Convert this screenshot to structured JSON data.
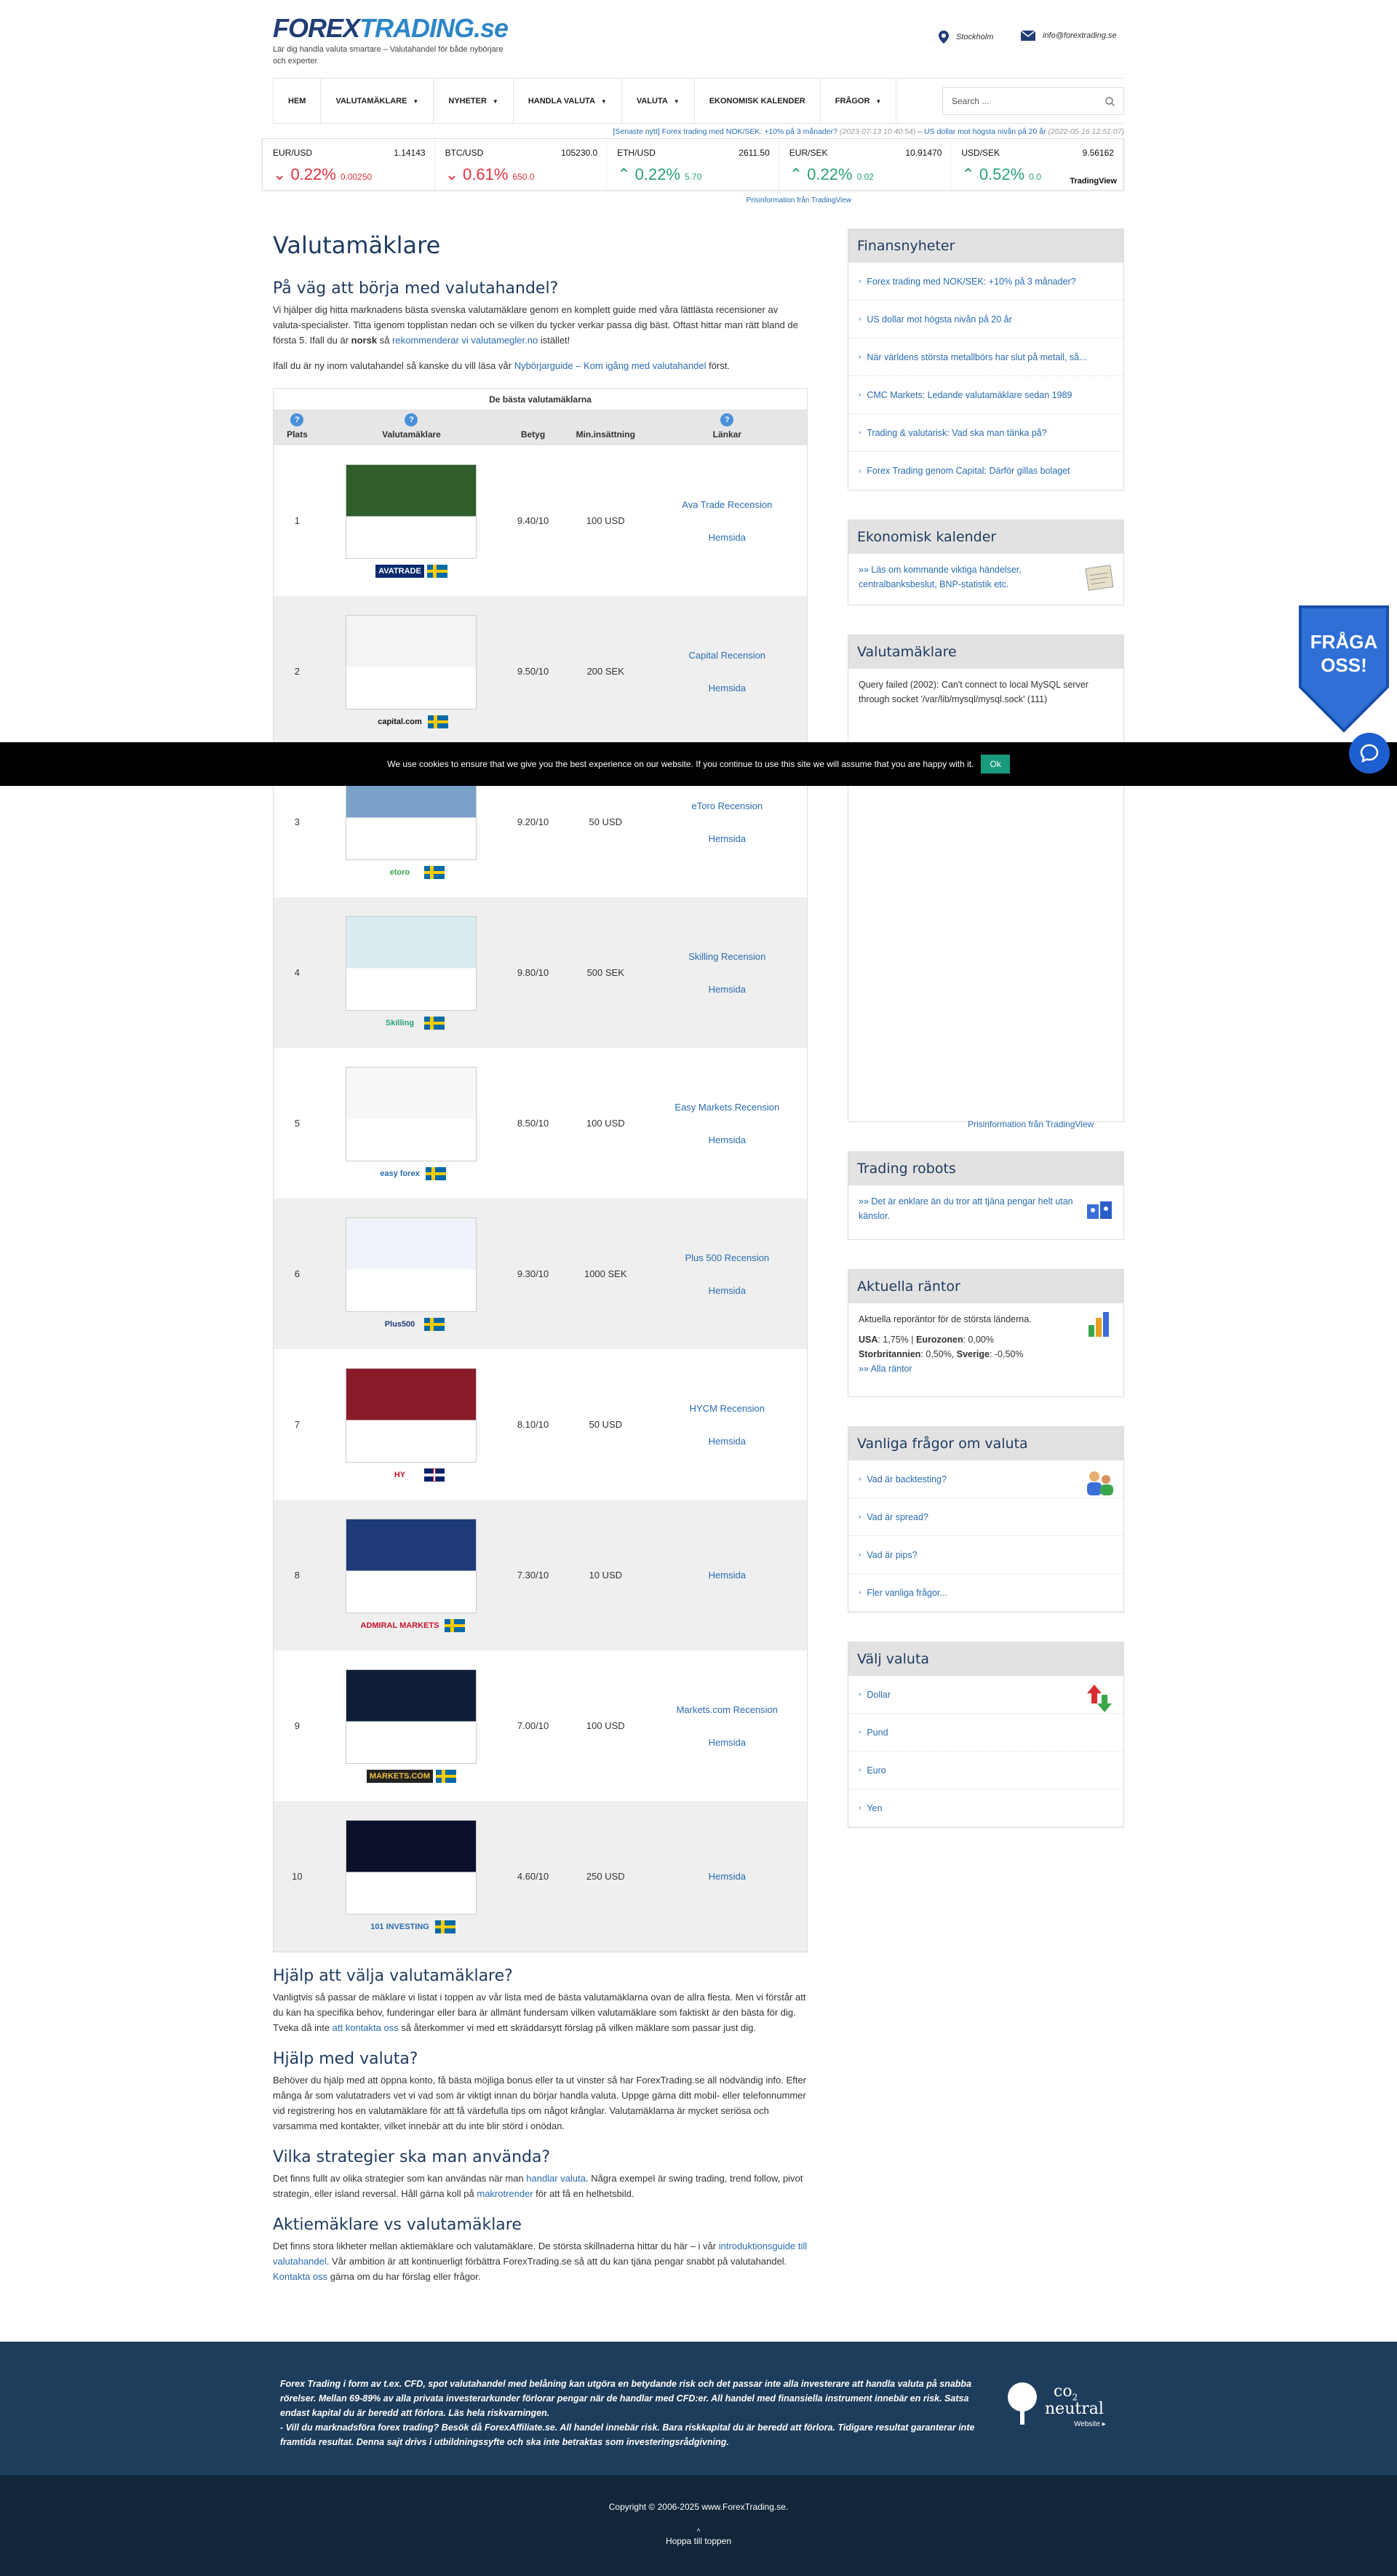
{
  "header": {
    "logo_a": "FOREX",
    "logo_b": "TRADING.se",
    "tagline": "Lär dig handla valuta smartare – Valutahandel för både nybörjare och experter",
    "location": "Stockholm",
    "email": "info@forextrading.se"
  },
  "nav": {
    "items": [
      {
        "label": "HEM",
        "caret": false
      },
      {
        "label": "VALUTAMÄKLARE",
        "caret": true
      },
      {
        "label": "NYHETER",
        "caret": true
      },
      {
        "label": "HANDLA VALUTA",
        "caret": true
      },
      {
        "label": "VALUTA",
        "caret": true
      },
      {
        "label": "EKONOMISK KALENDER",
        "caret": false
      },
      {
        "label": "FRÅGOR",
        "caret": true
      }
    ],
    "search_placeholder": "Search ..."
  },
  "newsline": {
    "label": "[Senaste nytt]",
    "item1": "Forex trading med NOK/SEK: +10% på 3 månader?",
    "date1": "(2023-07-13 10:40:54)",
    "item2": "US dollar mot högsta nivån på 20 år",
    "date2": "(2022-05-16 12:51:07)"
  },
  "ticker": [
    {
      "symbol": "EUR/USD",
      "price": "1.14143",
      "pct": "0.22%",
      "abs": "0.00250",
      "dir": "down"
    },
    {
      "symbol": "BTC/USD",
      "price": "105230.0",
      "pct": "0.61%",
      "abs": "650.0",
      "dir": "down"
    },
    {
      "symbol": "ETH/USD",
      "price": "2611.50",
      "pct": "0.22%",
      "abs": "5.70",
      "dir": "up"
    },
    {
      "symbol": "EUR/SEK",
      "price": "10.91470",
      "pct": "0.22%",
      "abs": "0.02",
      "dir": "up"
    },
    {
      "symbol": "USD/SEK",
      "price": "9.56162",
      "pct": "0.52%",
      "abs": "0.0",
      "dir": "up"
    }
  ],
  "ticker_brand": "TradingView",
  "ticker_attr": "Prisinformation från TradingView",
  "main": {
    "title": "Valutamäklare",
    "intro_heading": "På väg att börja med valutahandel?",
    "intro_p1_a": "Vi hjälper dig hitta marknadens bästa svenska valutamäklare genom en komplett guide med våra lättlästa recensioner av valuta-specialister. Titta igenom topplistan nedan och se vilken du tycker verkar passa dig bäst. Oftast hittar man rätt bland de första 5. Ifall du är ",
    "intro_p1_bold": "norsk",
    "intro_p1_b": " så ",
    "intro_p1_link": "rekommenderar vi valutamegler.no",
    "intro_p1_c": " istället!",
    "intro_p2_a": "Ifall du är ny inom valutahandel så kanske du vill läsa vår ",
    "intro_p2_link": "Nybörjarguide – Kom igång med valutahandel",
    "intro_p2_b": " först.",
    "table_caption": "De bästa valutamäklarna",
    "col_place": "Plats",
    "col_broker": "Valutamäklare",
    "col_rating": "Betyg",
    "col_min": "Min.insättning",
    "col_links": "Länkar",
    "brokers": [
      {
        "place": "1",
        "logo": "AVATRADE",
        "rating": "9.40/10",
        "min": "100 USD",
        "review": "Ava Trade Recension",
        "site": "Hemsida",
        "flag": "se"
      },
      {
        "place": "2",
        "logo": "capital.com",
        "rating": "9.50/10",
        "min": "200 SEK",
        "review": "Capital Recension",
        "site": "Hemsida",
        "flag": "se"
      },
      {
        "place": "3",
        "logo": "etoro",
        "rating": "9.20/10",
        "min": "50 USD",
        "review": "eToro Recension",
        "site": "Hemsida",
        "flag": "se"
      },
      {
        "place": "4",
        "logo": "Skilling",
        "rating": "9.80/10",
        "min": "500 SEK",
        "review": "Skilling Recension",
        "site": "Hemsida",
        "flag": "se"
      },
      {
        "place": "5",
        "logo": "easy forex",
        "rating": "8.50/10",
        "min": "100 USD",
        "review": "Easy Markets Recension",
        "site": "Hemsida",
        "flag": "se"
      },
      {
        "place": "6",
        "logo": "Plus500",
        "rating": "9.30/10",
        "min": "1000 SEK",
        "review": "Plus 500 Recension",
        "site": "Hemsida",
        "flag": "se"
      },
      {
        "place": "7",
        "logo": "HY",
        "rating": "8.10/10",
        "min": "50 USD",
        "review": "HYCM Recension",
        "site": "Hemsida",
        "flag": "uk"
      },
      {
        "place": "8",
        "logo": "ADMIRAL MARKETS",
        "rating": "7.30/10",
        "min": "10 USD",
        "review": "",
        "site": "Hemsida",
        "flag": "se"
      },
      {
        "place": "9",
        "logo": "MARKETS.COM",
        "rating": "7.00/10",
        "min": "100 USD",
        "review": "Markets.com Recension",
        "site": "Hemsida",
        "flag": "se"
      },
      {
        "place": "10",
        "logo": "101 INVESTING",
        "rating": "4.60/10",
        "min": "250 USD",
        "review": "",
        "site": "Hemsida",
        "flag": "se"
      }
    ],
    "s1_heading": "Hjälp att välja valutamäklare?",
    "s1_a": "Vanligtvis så passar de mäklare vi listat i toppen av vår lista med de bästa valutamäklarna ovan de allra flesta. Men vi förstår att du kan ha specifika behov, funderingar eller bara är allmänt fundersam vilken valutamäklare som faktiskt är den bästa för dig. Tveka då inte ",
    "s1_link": "att kontakta oss",
    "s1_b": " så återkommer vi med ett skräddarsytt förslag på vilken mäklare som passar just dig.",
    "s2_heading": "Hjälp med valuta?",
    "s2_text": "Behöver du hjälp med att öppna konto, få bästa möjliga bonus eller ta ut vinster så har ForexTrading.se all nödvändig info. Efter många år som valutatraders vet vi vad som är viktigt innan du börjar handla valuta. Uppge gärna ditt mobil- eller telefonnummer vid registrering hos en valutamäklare för att få värdefulla tips om något krånglar. Valutamäklarna är mycket seriösa och varsamma med kontakter, vilket innebär att du inte blir störd i onödan.",
    "s3_heading": "Vilka strategier ska man använda?",
    "s3_a": "Det finns fullt av olika strategier som kan användas när man ",
    "s3_link1": "handlar valuta",
    "s3_b": ". Några exempel är swing trading, trend follow, pivot strategin, eller island reversal. Håll gärna koll på ",
    "s3_link2": "makrotrender",
    "s3_c": " för att få en helhetsbild.",
    "s4_heading": "Aktiemäklare vs valutamäklare",
    "s4_a": "Det finns stora likheter mellan aktiemäklare och valutamäklare. De största skillnaderna hittar du här – i vår ",
    "s4_link1": "introduktionsguide till valutahandel",
    "s4_b": ". Vår ambition är att kontinuerligt förbättra ForexTrading.se så att du kan tjäna pengar snabbt på valutahandel. ",
    "s4_link2": "Kontakta oss",
    "s4_c": " gärna om du har förslag eller frågor."
  },
  "sidebar": {
    "news_title": "Finansnyheter",
    "news": [
      "Forex trading med NOK/SEK: +10% på 3 månader?",
      "US dollar mot högsta nivån på 20 år",
      "När världens största metallbörs har slut på metall, så...",
      "CMC Markets: Ledande valutamäklare sedan 1989",
      "Trading & valutarisk: Vad ska man tänka på?",
      "Forex Trading genom Capital: Därför gillas bolaget"
    ],
    "cal_title": "Ekonomisk kalender",
    "cal_text": "»» Läs om kommande viktiga händelser, centralbanksbeslut, BNP-statistik etc.",
    "broker_title": "Valutamäklare",
    "broker_error": "Query failed (2002): Can't connect to local MySQL server through socket '/var/lib/mysql/mysql.sock' (111)",
    "tv_attr": "Prisinformation från TradingView",
    "robots_title": "Trading robots",
    "robots_text": "»» Det är enklare än du tror att tjäna pengar helt utan känslor.",
    "rates_title": "Aktuella räntor",
    "rates_intro": "Aktuella reporäntor för de största länderna.",
    "rates_usa_l": "USA",
    "rates_usa": ": 1,75% | ",
    "rates_euro_l": "Eurozonen",
    "rates_euro": ": 0,00%",
    "rates_uk_l": "Storbritannien",
    "rates_uk": ": 0,50%, ",
    "rates_se_l": "Sverige",
    "rates_se": ": -0,50%",
    "rates_all": "»» Alla räntor",
    "faq_title": "Vanliga frågor om valuta",
    "faq": [
      "Vad är backtesting?",
      "Vad är spread?",
      "Vad är pips?",
      "Fler vanliga frågor..."
    ],
    "cur_title": "Välj valuta",
    "currencies": [
      "Dollar",
      "Pund",
      "Euro",
      "Yen"
    ]
  },
  "cookie": {
    "text": "We use cookies to ensure that we give you the best experience on our website. If you continue to use this site we will assume that you are happy with it.",
    "ok": "Ok"
  },
  "fraga": {
    "line1": "FRÅGA",
    "line2": "OSS!"
  },
  "footer": {
    "disclaimer": "Forex Trading i form av t.ex. CFD, spot valutahandel med belåning kan utgöra en betydande risk och det passar inte alla investerare att handla valuta på snabba rörelser. Mellan 69-89% av alla privata investerarkunder förlorar pengar när de handlar med CFD:er. All handel med finansiella instrument innebär en risk. Satsa endast kapital du är beredd att förlora. Läs hela riskvarningen.",
    "disclaimer2": "- Vill du marknadsföra forex trading? Besök då ForexAffiliate.se. All handel innebär risk. Bara riskkapital du är beredd att förlora. Tidigare resultat garanterar inte framtida resultat. Denna sajt drivs i utbildningssyfte och ska inte betraktas som investeringsrådgivning.",
    "co2_a": "co",
    "co2_sub": "2",
    "co2_b": "neutral",
    "co2_c": "Website ▸",
    "copyright": "Copyright © 2006-2025 www.ForexTrading.se.",
    "top": "Hoppa till toppen",
    "top_arrow": "^"
  }
}
